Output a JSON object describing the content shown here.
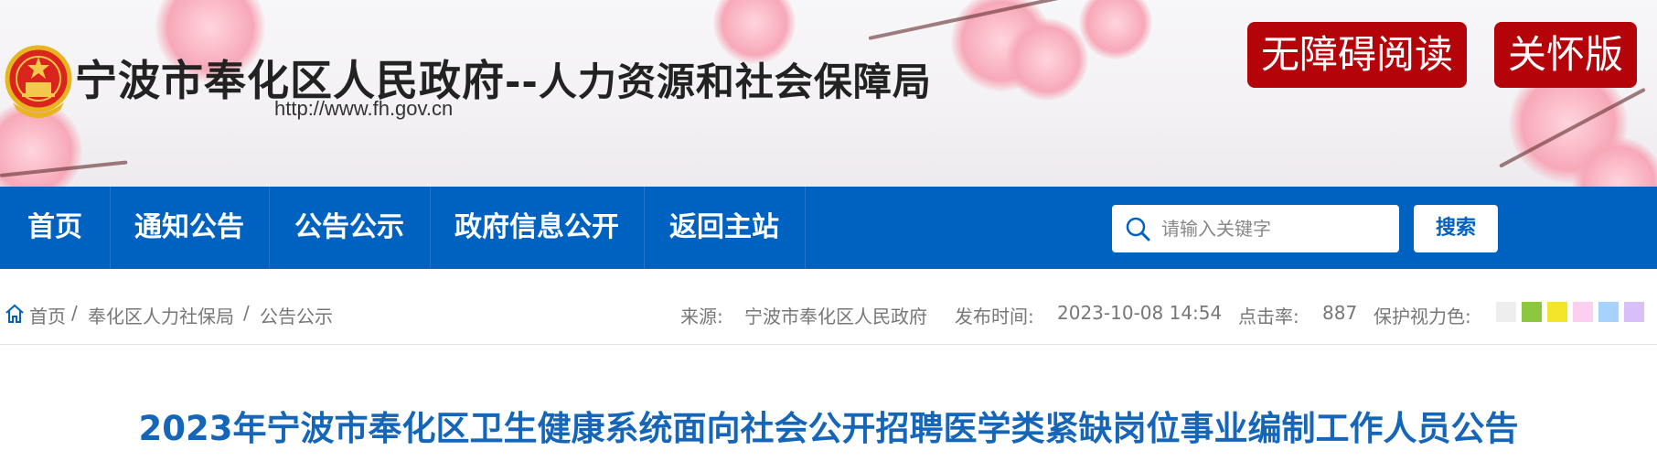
{
  "header": {
    "title_main": "宁波市奉化区人民政府",
    "title_sub": "--人力资源和社会保障局",
    "url": "http://www.fh.gov.cn",
    "accessibility_label": "无障碍阅读",
    "care_label": "关怀版"
  },
  "nav": {
    "items": [
      {
        "label": "首页"
      },
      {
        "label": "通知公告"
      },
      {
        "label": "公告公示"
      },
      {
        "label": "政府信息公开"
      },
      {
        "label": "返回主站"
      }
    ],
    "search_placeholder": "请输入关键字",
    "search_button": "搜索",
    "color": "#0062c0"
  },
  "breadcrumb": {
    "items": [
      "首页",
      "奉化区人力社保局",
      "公告公示"
    ],
    "separator": "/"
  },
  "meta": {
    "source_label": "来源:",
    "source_value": "宁波市奉化区人民政府",
    "time_label": "发布时间:",
    "time_value": "2023-10-08 14:54",
    "clicks_label": "点击率:",
    "clicks_value": "887",
    "eye_color_label": "保护视力色:",
    "eye_colors": [
      "#eeeeee",
      "#8dc63f",
      "#f5e52a",
      "#fccff0",
      "#a6d2fc",
      "#d8bffa"
    ]
  },
  "article": {
    "title": "2023年宁波市奉化区卫生健康系统面向社会公开招聘医学类紧缺岗位事业编制工作人员公告",
    "title_color": "#1565b8"
  }
}
